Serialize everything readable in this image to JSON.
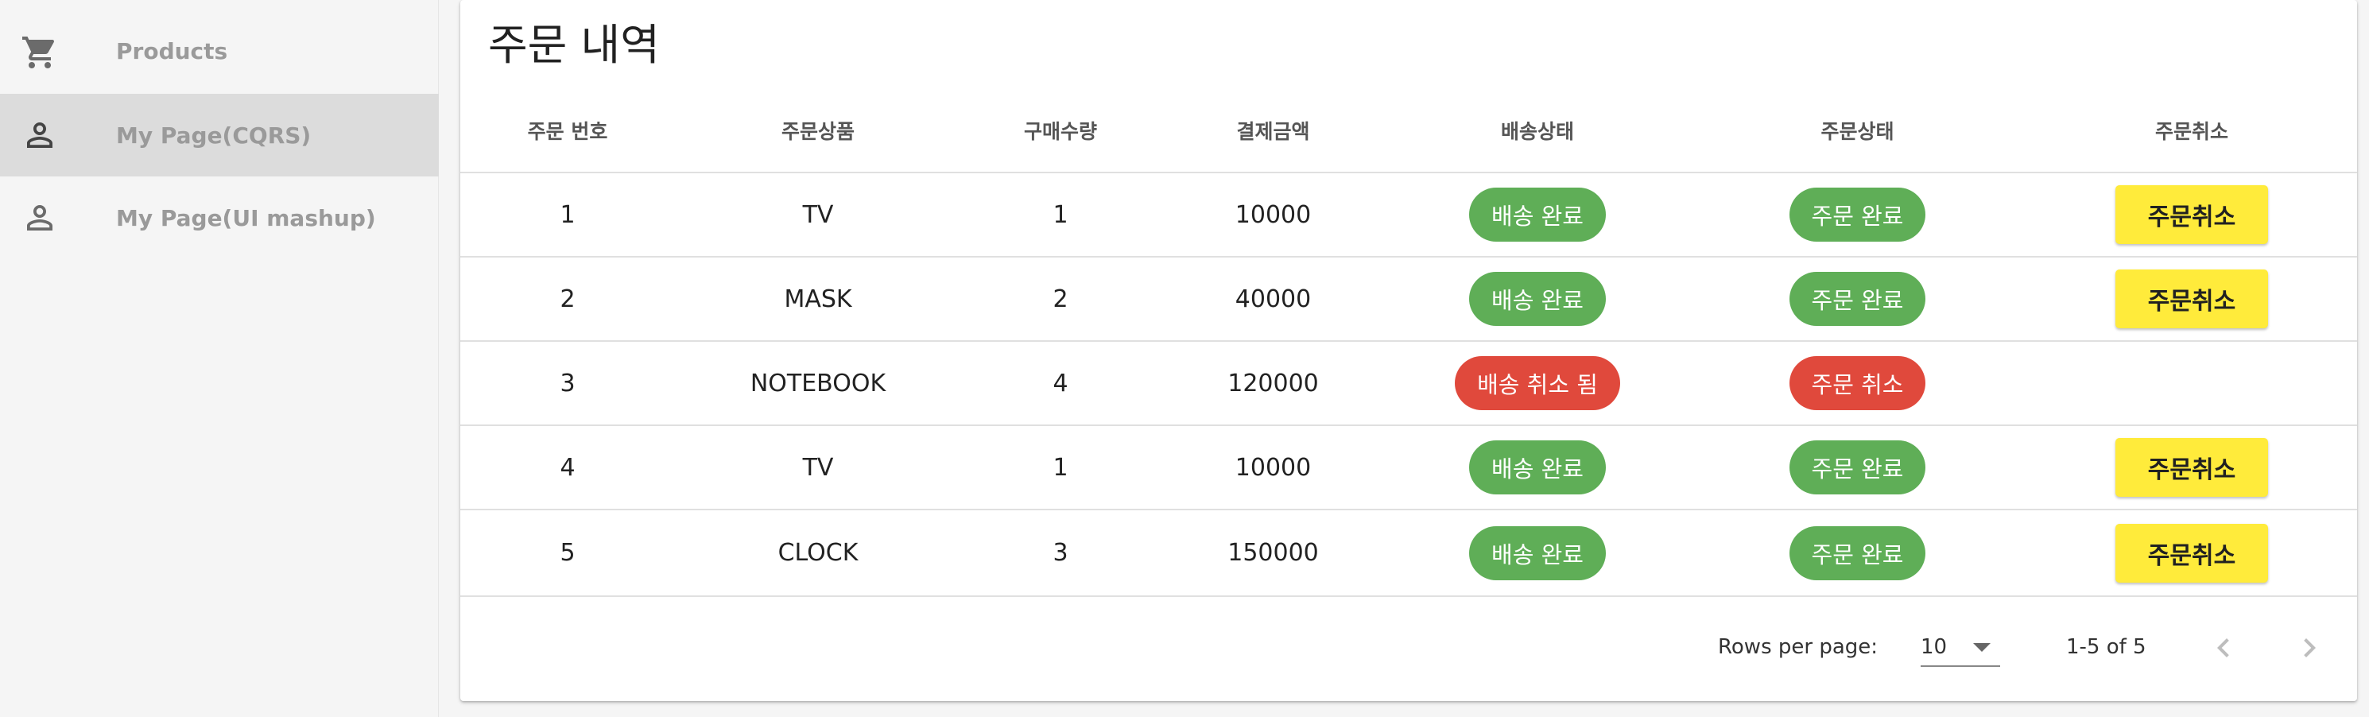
{
  "sidebar": {
    "items": [
      {
        "label": "Products",
        "icon": "cart-icon"
      },
      {
        "label": "My Page(CQRS)",
        "icon": "person-icon",
        "active": true
      },
      {
        "label": "My Page(UI mashup)",
        "icon": "person-icon"
      }
    ]
  },
  "page": {
    "title": "주문 내역"
  },
  "table": {
    "headers": [
      "주문 번호",
      "주문상품",
      "구매수량",
      "결제금액",
      "배송상태",
      "주문상태",
      "주문취소"
    ],
    "rows": [
      {
        "id": "1",
        "product": "TV",
        "qty": "1",
        "amount": "10000",
        "delivery": "배송 완료",
        "order": "주문 완료",
        "cancel": "주문취소"
      },
      {
        "id": "2",
        "product": "MASK",
        "qty": "2",
        "amount": "40000",
        "delivery": "배송 완료",
        "order": "주문 완료",
        "cancel": "주문취소"
      },
      {
        "id": "3",
        "product": "NOTEBOOK",
        "qty": "4",
        "amount": "120000",
        "delivery": "배송 취소 됨",
        "order": "주문 취소",
        "cancel": ""
      },
      {
        "id": "4",
        "product": "TV",
        "qty": "1",
        "amount": "10000",
        "delivery": "배송 완료",
        "order": "주문 완료",
        "cancel": "주문취소"
      },
      {
        "id": "5",
        "product": "CLOCK",
        "qty": "3",
        "amount": "150000",
        "delivery": "배송 완료",
        "order": "주문 완료",
        "cancel": "주문취소"
      }
    ]
  },
  "pagination": {
    "rows_per_page_label": "Rows per page:",
    "rows_per_page_value": "10",
    "range": "1-5 of 5"
  },
  "colors": {
    "success": "#5fae57",
    "danger": "#e0493c",
    "cancel_button": "#ffeb3b",
    "active_nav": "#dcdcdc"
  }
}
